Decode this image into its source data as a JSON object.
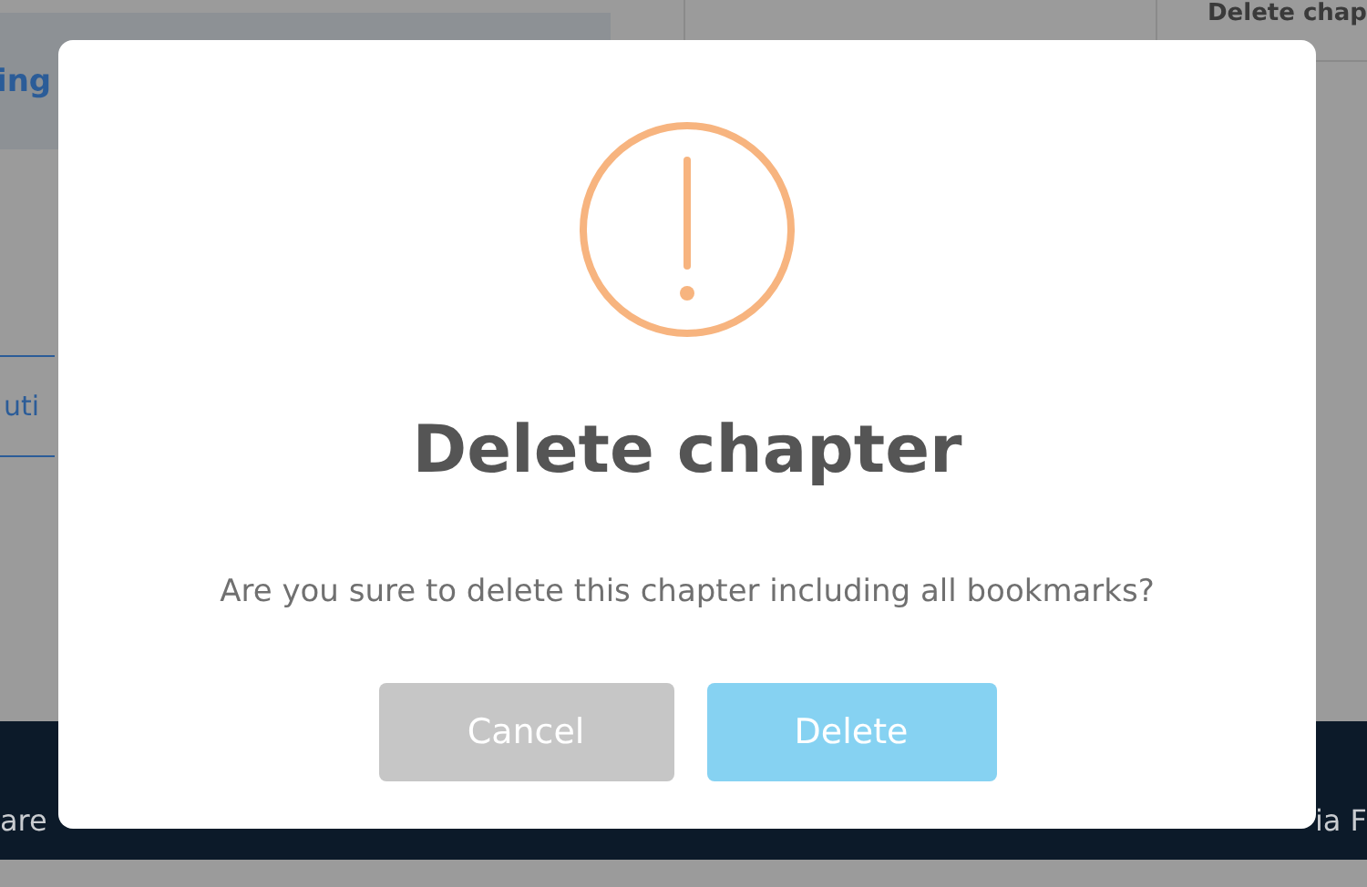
{
  "background": {
    "panel_heading": "ing",
    "column_heading": "Delete chap",
    "side_button": "uti",
    "footer_left": "are",
    "footer_right": "ia F"
  },
  "dialog": {
    "title": "Delete chapter",
    "message": "Are you sure to delete this chapter including all bookmarks?",
    "buttons": [
      {
        "label": "Cancel",
        "kind": "cancel"
      },
      {
        "label": "Delete",
        "kind": "confirm"
      }
    ]
  }
}
